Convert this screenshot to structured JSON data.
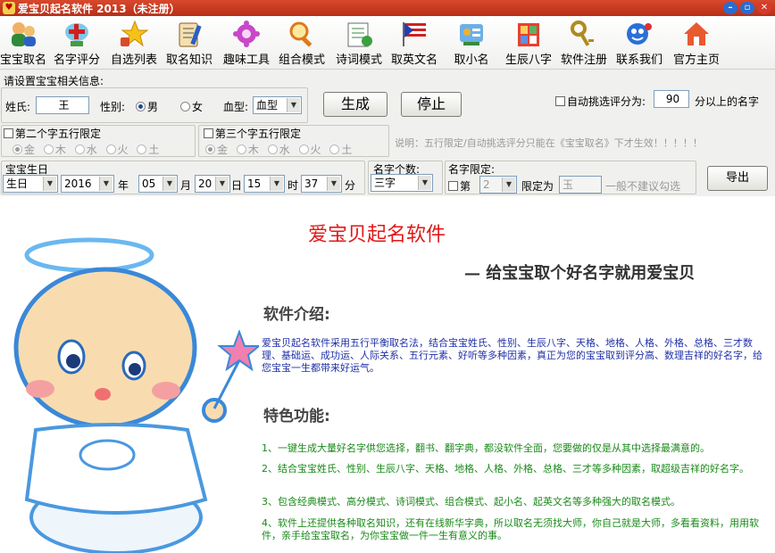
{
  "window": {
    "title": "爱宝贝起名软件 2013（未注册）",
    "icon": "app-icon"
  },
  "toolbar": [
    {
      "label": "宝宝取名",
      "icon": "baby-icon"
    },
    {
      "label": "名字评分",
      "icon": "score-icon"
    },
    {
      "label": "自选列表",
      "icon": "star-list-icon"
    },
    {
      "label": "取名知识",
      "icon": "book-icon"
    },
    {
      "label": "趣味工具",
      "icon": "gear-icon"
    },
    {
      "label": "组合模式",
      "icon": "magnifier-icon"
    },
    {
      "label": "诗词模式",
      "icon": "poem-icon"
    },
    {
      "label": "取英文名",
      "icon": "flag-icon"
    },
    {
      "label": "取小名",
      "icon": "tools-icon"
    },
    {
      "label": "生辰八字",
      "icon": "bazi-icon"
    },
    {
      "label": "软件注册",
      "icon": "key-icon"
    },
    {
      "label": "联系我们",
      "icon": "contact-icon"
    },
    {
      "label": "官方主页",
      "icon": "home-icon"
    }
  ],
  "form": {
    "section_title": "请设置宝宝相关信息:",
    "surname_label": "姓氏:",
    "surname_value": "王",
    "gender_label": "性别:",
    "gender_male": "男",
    "gender_female": "女",
    "blood_label": "血型:",
    "blood_value": "血型",
    "generate_btn": "生成",
    "stop_btn": "停止",
    "auto_score_label": "自动挑选评分为:",
    "auto_score_value": "90",
    "auto_score_suffix": "分以上的名字",
    "second_char_label": "第二个字五行限定",
    "third_char_label": "第三个字五行限定",
    "elements": [
      "金",
      "木",
      "水",
      "火",
      "土"
    ],
    "note": "说明：五行限定/自动挑选评分只能在《宝宝取名》下才生效！！！！！",
    "birthday_label": "宝宝生日",
    "birth_type": "生日",
    "year": "2016",
    "year_unit": "年",
    "month": "05",
    "month_unit": "月",
    "day": "20",
    "day_unit": "日",
    "hour": "15",
    "hour_unit": "时",
    "minute": "37",
    "minute_unit": "分",
    "name_len_label": "名字个数:",
    "name_len_value": "三字",
    "name_limit_label": "名字限定:",
    "limit_pos_prefix": "第",
    "limit_pos_value": "2",
    "limit_as_label": "限定为",
    "limit_char_value": "玉",
    "limit_hint": "一般不建议勾选",
    "export_btn": "导出"
  },
  "intro": {
    "app_name": "爱宝贝起名软件",
    "slogan": "— 给宝宝取个好名字就用爱宝贝",
    "intro_heading": "软件介绍:",
    "intro_text": "爱宝贝起名软件采用五行平衡取名法，结合宝宝姓氏、性别、生辰八字、天格、地格、人格、外格、总格、三才数理、基础运、成功运、人际关系、五行元素、好听等多种因素，真正为您的宝宝取到评分高、数理吉祥的好名字，给您宝宝一生都带来好运气。",
    "features_heading": "特色功能:",
    "features": [
      "1、一键生成大量好名字供您选择，翻书、翻字典，都没软件全面，您要做的仅是从其中选择最满意的。",
      "2、结合宝宝姓氏、性别、生辰八字、天格、地格、人格、外格、总格、三才等多种因素，取超级吉祥的好名字。",
      "3、包含经典模式、高分模式、诗词模式、组合模式、起小名、起英文名等多种强大的取名模式。",
      "4、软件上还提供各种取名知识，还有在线新华字典，所以取名无须找大师，你自己就是大师，多看看资料，用用软件，亲手给宝宝取名，为你宝宝做一件一生有意义的事。"
    ]
  },
  "colors": {
    "titlebar": "#c83a20",
    "heading_green": "#1a8a1a",
    "intro_blue": "#2030a8",
    "app_name_red": "#e01818"
  }
}
